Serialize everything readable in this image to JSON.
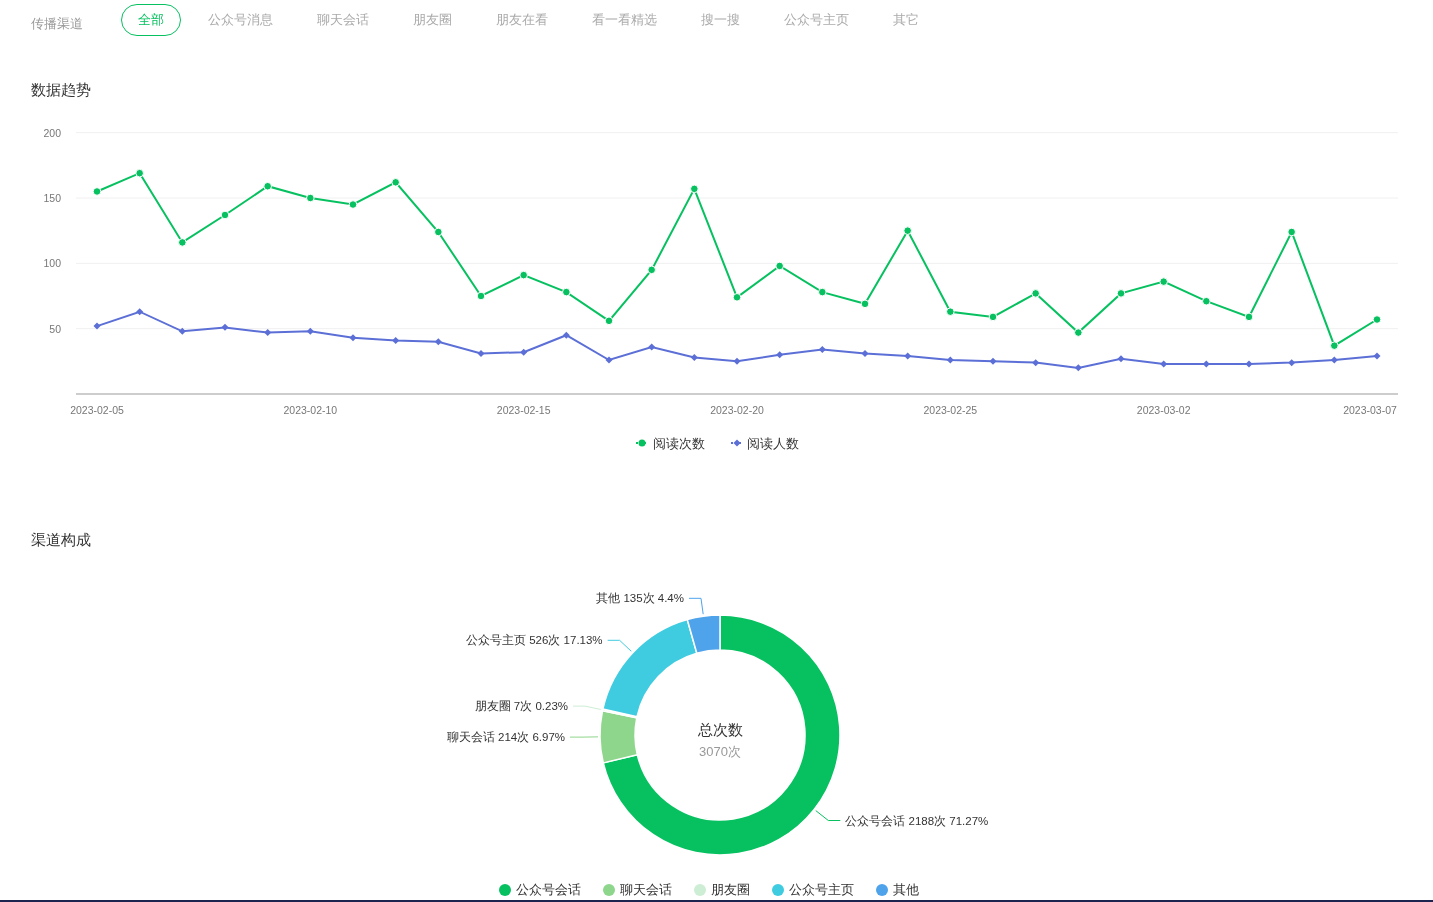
{
  "filter": {
    "label": "传播渠道",
    "tabs": [
      {
        "label": "全部",
        "selected": true
      },
      {
        "label": "公众号消息",
        "selected": false
      },
      {
        "label": "聊天会话",
        "selected": false
      },
      {
        "label": "朋友圈",
        "selected": false
      },
      {
        "label": "朋友在看",
        "selected": false
      },
      {
        "label": "看一看精选",
        "selected": false
      },
      {
        "label": "搜一搜",
        "selected": false
      },
      {
        "label": "公众号主页",
        "selected": false
      },
      {
        "label": "其它",
        "selected": false
      }
    ]
  },
  "trend": {
    "title": "数据趋势",
    "chart_data": {
      "type": "line",
      "categories": [
        "2023-02-05",
        null,
        null,
        null,
        null,
        "2023-02-10",
        null,
        null,
        null,
        null,
        "2023-02-15",
        null,
        null,
        null,
        null,
        "2023-02-20",
        null,
        null,
        null,
        null,
        "2023-02-25",
        null,
        null,
        null,
        null,
        "2023-03-02",
        null,
        null,
        null,
        null,
        "2023-03-07"
      ],
      "grid": true,
      "legend": true,
      "series": [
        {
          "name": "阅读次数",
          "color": "#07c160",
          "marker": "circle",
          "values": [
            155,
            169,
            116,
            137,
            159,
            150,
            145,
            162,
            124,
            75,
            91,
            78,
            56,
            95,
            157,
            74,
            98,
            78,
            69,
            125,
            63,
            59,
            77,
            47,
            77,
            86,
            71,
            59,
            124,
            37,
            57
          ]
        },
        {
          "name": "阅读人数",
          "color": "#5b6fd6",
          "marker": "diamond",
          "values": [
            52,
            63,
            48,
            51,
            47,
            48,
            43,
            41,
            40,
            31,
            32,
            45,
            26,
            36,
            28,
            25,
            30,
            34,
            31,
            29,
            26,
            25,
            24,
            20,
            27,
            23,
            23,
            23,
            24,
            26,
            29
          ]
        }
      ],
      "ylim": [
        0,
        200
      ],
      "yticks": [
        50,
        100,
        150,
        200
      ]
    }
  },
  "channels": {
    "title": "渠道构成",
    "center": {
      "title": "总次数",
      "value": "3070次"
    },
    "chart_data": {
      "type": "donut",
      "categories": [
        "公众号会话",
        "聊天会话",
        "朋友圈",
        "公众号主页",
        "其他"
      ],
      "values": [
        2188,
        214,
        7,
        526,
        135
      ],
      "colors": [
        "#07c160",
        "#8ed68b",
        "#cdeed4",
        "#40cce0",
        "#4fa3ea"
      ],
      "value_labels": [
        "公众号会话 2188次 71.27%",
        "聊天会话 214次 6.97%",
        "朋友圈 7次 0.23%",
        "公众号主页 526次 17.13%",
        "其他 135次 4.4%"
      ]
    }
  }
}
